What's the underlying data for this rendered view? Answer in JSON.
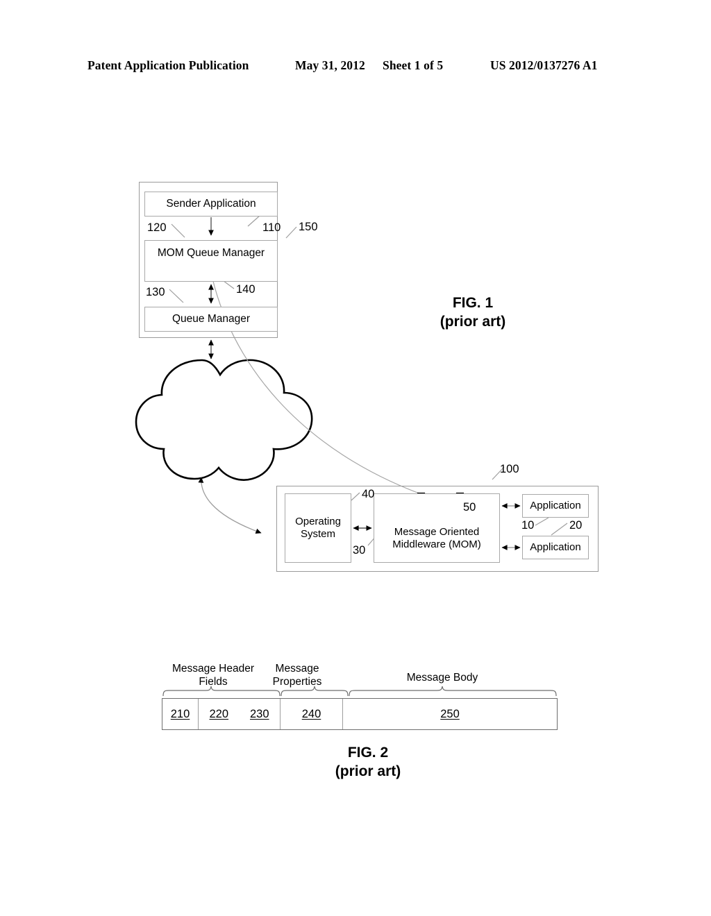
{
  "header": {
    "publication": "Patent Application Publication",
    "date": "May 31, 2012",
    "sheet": "Sheet 1 of 5",
    "document_number": "US 2012/0137276 A1"
  },
  "figures": [
    {
      "id": "fig1",
      "caption_line1": "FIG. 1",
      "caption_line2": "(prior art)",
      "boxes": {
        "sender_application": "Sender Application",
        "mom_queue_manager": "MOM Queue Manager",
        "queue_manager": "Queue Manager",
        "operating_system": "Operating\nSystem",
        "operating_system_line1": "Operating",
        "operating_system_line2": "System",
        "mom_line1": "Message Oriented",
        "mom_line2": "Middleware (MOM)",
        "application_1": "Application",
        "application_2": "Application"
      },
      "refs": {
        "r110": "110",
        "r120": "120",
        "r130": "130",
        "r140": "140",
        "r150": "150",
        "r100": "100",
        "r40": "40",
        "r30": "30",
        "r50": "50",
        "r10": "10",
        "r20": "20"
      },
      "icons": {
        "queue_mom_qm": "queue-icon",
        "queue_mom": "queue-icon",
        "network": "cloud-icon"
      }
    },
    {
      "id": "fig2",
      "caption_line1": "FIG. 2",
      "caption_line2": "(prior art)",
      "group_labels": {
        "header_fields_line1": "Message Header",
        "header_fields_line2": "Fields",
        "properties_line1": "Message",
        "properties_line2": "Properties",
        "body": "Message Body"
      },
      "segments": [
        {
          "numerals": [
            "210"
          ]
        },
        {
          "numerals": [
            "220",
            "230"
          ]
        },
        {
          "numerals": [
            "240"
          ]
        },
        {
          "numerals": [
            "250"
          ]
        }
      ]
    }
  ],
  "colors": {
    "ink": "#000000",
    "line_gray": "#9a9a9a",
    "leader_gray": "#9e9e9e",
    "paper": "#ffffff"
  }
}
